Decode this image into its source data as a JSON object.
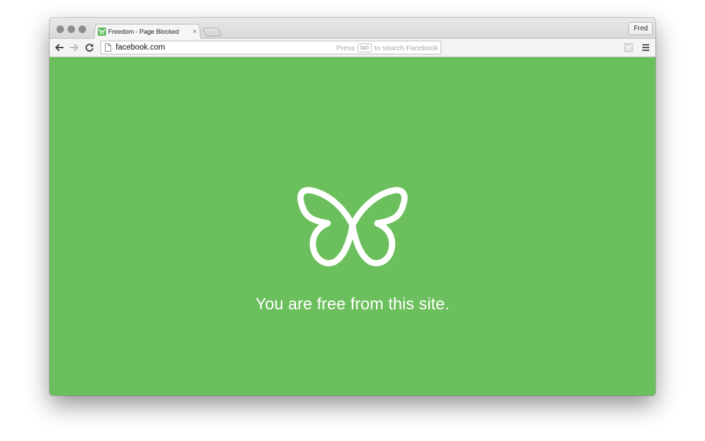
{
  "browser": {
    "tab": {
      "title": "Freedom - Page Blocked",
      "close_glyph": "×",
      "favicon_icon": "butterfly-icon"
    },
    "profile_name": "Fred",
    "toolbar": {
      "back_icon": "arrow-left-icon",
      "forward_icon": "arrow-right-icon",
      "reload_icon": "reload-icon",
      "menu_icon": "hamburger-menu-icon",
      "extension_icon": "freedom-extension-icon"
    },
    "omnibox": {
      "url": "facebook.com",
      "hint_prefix": "Press",
      "hint_key": "tab",
      "hint_suffix": "to search Facebook"
    }
  },
  "page": {
    "logo_icon": "butterfly-icon",
    "message": "You are free from this site."
  },
  "colors": {
    "page_background": "#6cbf5d",
    "logo": "#ffffff",
    "message_text": "#ffffff"
  }
}
